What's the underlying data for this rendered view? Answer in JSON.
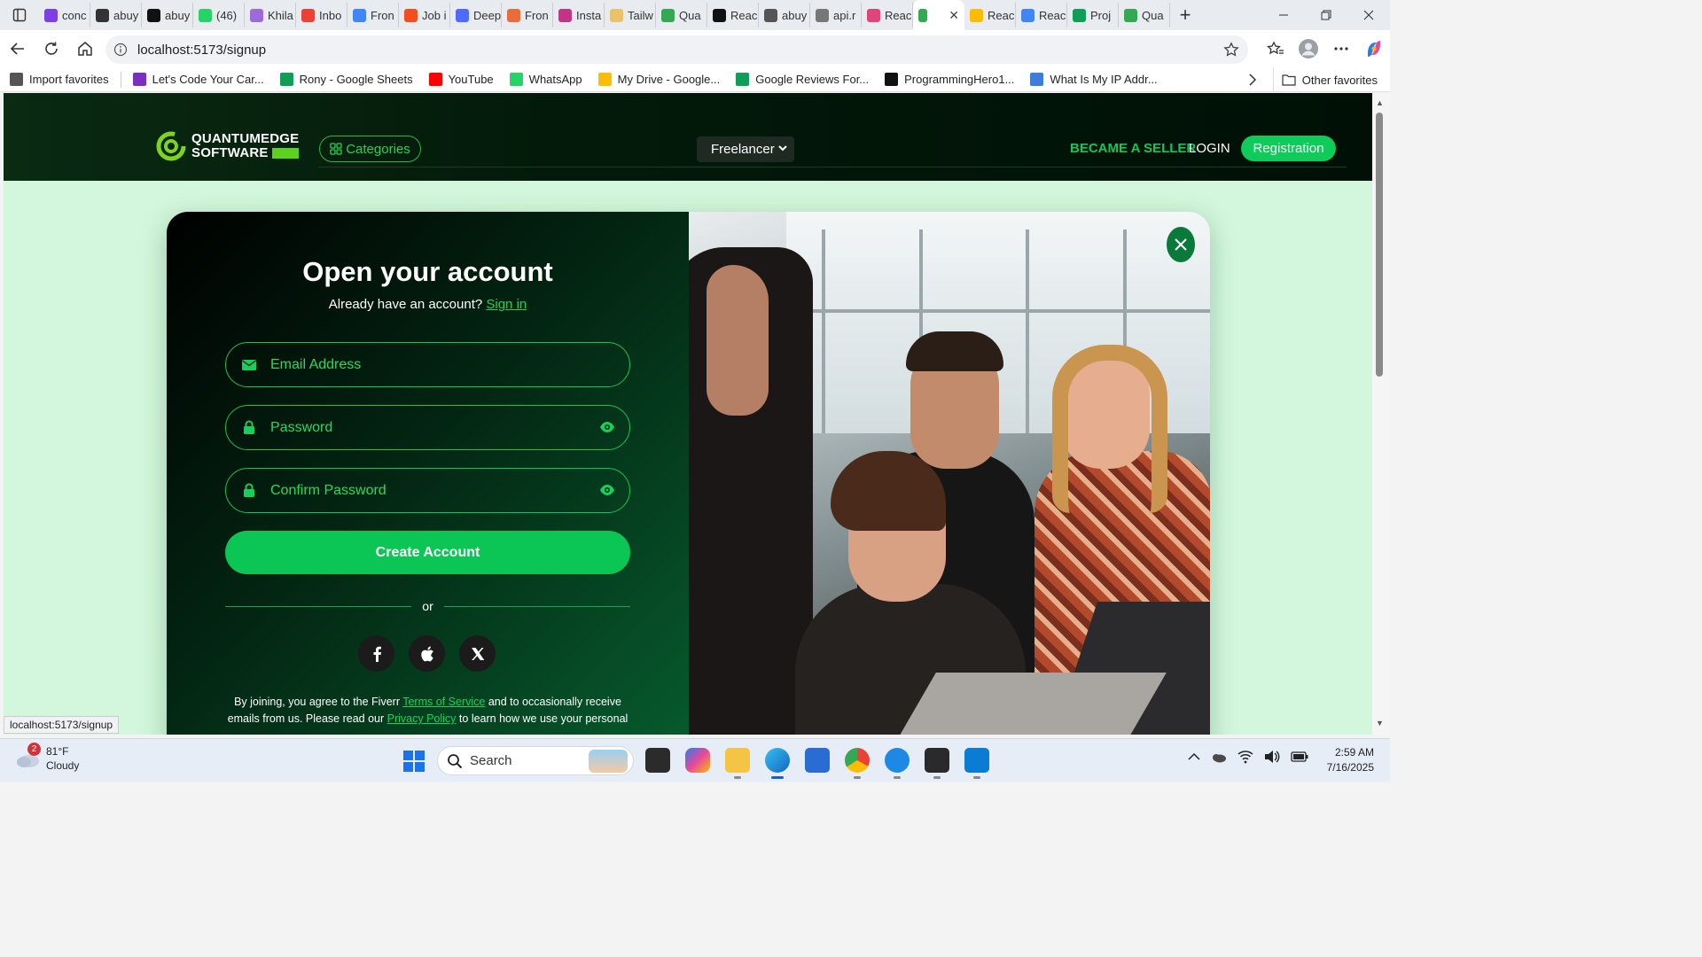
{
  "browser": {
    "tabs": [
      {
        "title": "conc",
        "color": "#7b3fe4"
      },
      {
        "title": "abuy",
        "color": "#333333"
      },
      {
        "title": "abuy",
        "color": "#111111"
      },
      {
        "title": "(46)",
        "color": "#25d366"
      },
      {
        "title": "Khila",
        "color": "#9b6bd6"
      },
      {
        "title": "Inbo",
        "color": "#ea4335"
      },
      {
        "title": "Fron",
        "color": "#4285f4"
      },
      {
        "title": "Job i",
        "color": "#f24e1e"
      },
      {
        "title": "Deep",
        "color": "#4d6bfe"
      },
      {
        "title": "Fron",
        "color": "#e86d3a"
      },
      {
        "title": "Insta",
        "color": "#c13584"
      },
      {
        "title": "Tailw",
        "color": "#e8c36a"
      },
      {
        "title": "Qua",
        "color": "#34a853"
      },
      {
        "title": "Reac",
        "color": "#111111"
      },
      {
        "title": "abuy",
        "color": "#555555"
      },
      {
        "title": "api.r",
        "color": "#777777"
      },
      {
        "title": "Reac",
        "color": "#e0447a"
      }
    ],
    "tabs_after": [
      {
        "title": "Reac",
        "color": "#fbbc04"
      },
      {
        "title": "Reac",
        "color": "#4285f4"
      },
      {
        "title": "Proj",
        "color": "#0f9d58"
      },
      {
        "title": "Qua",
        "color": "#34a853"
      }
    ],
    "active_tab": {
      "title": "",
      "close_label": "✕",
      "color": "#34a853"
    },
    "new_tab_label": "+",
    "url": "localhost:5173/signup",
    "status_url": "localhost:5173/signup",
    "bookmarks": [
      {
        "label": "Import favorites",
        "color": "#555555"
      },
      {
        "label": "Let's Code Your Car...",
        "color": "#7b2fbe"
      },
      {
        "label": "Rony - Google Sheets",
        "color": "#0f9d58"
      },
      {
        "label": "YouTube",
        "color": "#ff0000"
      },
      {
        "label": "WhatsApp",
        "color": "#25d366"
      },
      {
        "label": "My Drive - Google...",
        "color": "#fbbc04"
      },
      {
        "label": "Google Reviews For...",
        "color": "#0f9d58"
      },
      {
        "label": "ProgrammingHero1...",
        "color": "#111111"
      },
      {
        "label": "What Is My IP Addr...",
        "color": "#3b7dd8"
      }
    ],
    "other_favorites": "Other favorites"
  },
  "site": {
    "logo_line1": "QUANTUMEDGE",
    "logo_line2": "SOFTWARE",
    "categories": "Categories",
    "freelancer_select": "Freelancer",
    "became_seller": "BECAME A SELLER",
    "login": "LOGIN",
    "registration": "Registration",
    "accent": "#0ecb5a"
  },
  "signup": {
    "title": "Open your account",
    "have_account": "Already have an account?",
    "sign_in": "Sign in",
    "email_placeholder": "Email Address",
    "password_placeholder": "Password",
    "confirm_placeholder": "Confirm Password",
    "create_button": "Create Account",
    "or": "or",
    "social": [
      "facebook-icon",
      "apple-icon",
      "x-icon"
    ],
    "terms_1": "By joining, you agree to the Fiverr",
    "terms_link": "Terms of Service",
    "terms_2": "and to occasionally receive",
    "terms_3": "emails from us. Please read our",
    "privacy_link": "Privacy Policy",
    "terms_4": "to learn how we use your personal"
  },
  "taskbar": {
    "temperature": "81°F",
    "condition": "Cloudy",
    "weather_badge": "2",
    "search": "Search",
    "time": "2:59 AM",
    "date": "7/16/2025"
  }
}
